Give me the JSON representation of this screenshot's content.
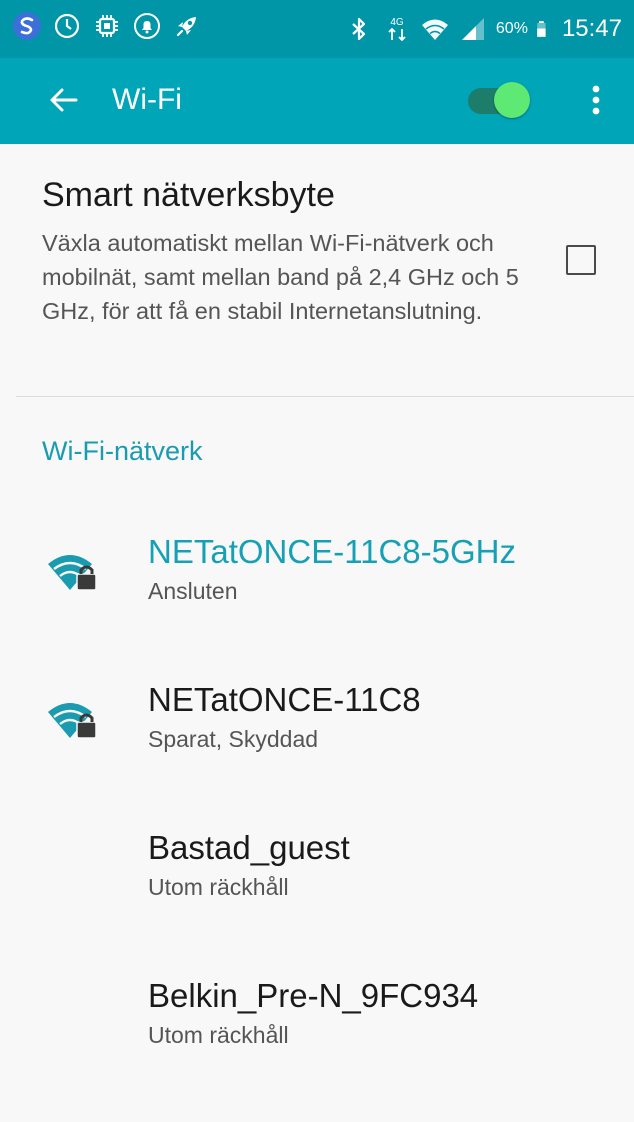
{
  "status_bar": {
    "time": "15:47",
    "battery_percent": "60%",
    "battery_level": 0.6,
    "network_type": "4G",
    "left_icons": [
      "app-s-icon",
      "sync-icon",
      "chip-icon",
      "notification-icon",
      "rocket-icon"
    ],
    "right_icons": [
      "bluetooth-icon",
      "data-arrows-icon",
      "wifi-icon",
      "cell-signal-icon",
      "battery-icon"
    ]
  },
  "app_bar": {
    "title": "Wi-Fi",
    "wifi_enabled": true
  },
  "smart_switch": {
    "title": "Smart nätverksbyte",
    "description": "Växla automatiskt mellan Wi-Fi-nätverk och mobilnät, samt mellan band på 2,4 GHz och 5 GHz, för att få en stabil Internetanslutning.",
    "checked": false
  },
  "networks_section": {
    "header": "Wi-Fi-nätverk",
    "items": [
      {
        "name": "NETatONCE-11C8-5GHz",
        "status": "Ansluten",
        "connected": true,
        "signal_icon": "wifi-lock-icon"
      },
      {
        "name": "NETatONCE-11C8",
        "status": "Sparat, Skyddad",
        "connected": false,
        "signal_icon": "wifi-lock-icon"
      },
      {
        "name": "Bastad_guest",
        "status": "Utom räckhåll",
        "connected": false
      },
      {
        "name": "Belkin_Pre-N_9FC934",
        "status": "Utom räckhåll",
        "connected": false
      }
    ]
  },
  "colors": {
    "status_bar": "#0096a8",
    "app_bar": "#00a5b8",
    "accent": "#16a0b4",
    "toggle_thumb": "#5ee874",
    "background": "#f8f8f8"
  }
}
